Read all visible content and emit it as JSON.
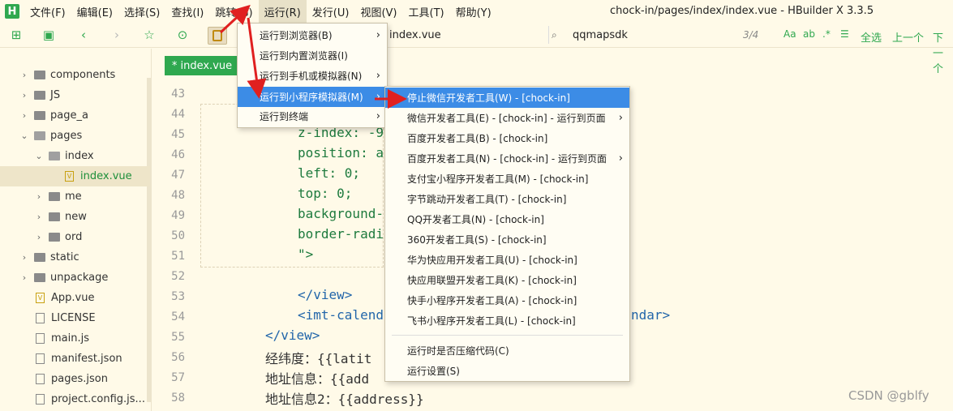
{
  "menubar": {
    "items": [
      "文件(F)",
      "编辑(E)",
      "选择(S)",
      "查找(I)",
      "跳转(G)",
      "运行(R)",
      "发行(U)",
      "视图(V)",
      "工具(T)",
      "帮助(Y)"
    ],
    "logo": "H",
    "window_title": "chock-in/pages/index/index.vue - HBuilder X 3.3.5"
  },
  "toolbar": {
    "breadcrumb_tail": "index.vue",
    "search_value": "qqmapsdk",
    "search_count": "3/4",
    "search_opts": [
      "Aa",
      "ab",
      ".*"
    ],
    "select_all": "全选",
    "prev": "上一个",
    "next": "下一个"
  },
  "sidebar": {
    "items": [
      {
        "label": "components",
        "type": "folder"
      },
      {
        "label": "JS",
        "type": "folder"
      },
      {
        "label": "page_a",
        "type": "folder"
      },
      {
        "label": "pages",
        "type": "folder-open"
      },
      {
        "label": "index",
        "type": "folder-open"
      },
      {
        "label": "index.vue",
        "type": "vue"
      },
      {
        "label": "me",
        "type": "folder"
      },
      {
        "label": "new",
        "type": "folder"
      },
      {
        "label": "ord",
        "type": "folder"
      },
      {
        "label": "static",
        "type": "folder"
      },
      {
        "label": "unpackage",
        "type": "folder"
      },
      {
        "label": "App.vue",
        "type": "vue"
      },
      {
        "label": "LICENSE",
        "type": "file"
      },
      {
        "label": "main.js",
        "type": "file"
      },
      {
        "label": "manifest.json",
        "type": "file"
      },
      {
        "label": "pages.json",
        "type": "file"
      },
      {
        "label": "project.config.js...",
        "type": "file"
      }
    ]
  },
  "editor": {
    "tab_label": "* index.vue",
    "line_numbers": [
      "43",
      "44",
      "45",
      "46",
      "47",
      "48",
      "49",
      "50",
      "51",
      "52",
      "53",
      "54",
      "55",
      "56",
      "57",
      "58"
    ],
    "lines": [
      {
        "text": "",
        "cls": ""
      },
      {
        "text": "",
        "cls": ""
      },
      {
        "text": "z-index: -9",
        "cls": "attr"
      },
      {
        "text": "position: a",
        "cls": "attr"
      },
      {
        "text": "left: 0;",
        "cls": "attr"
      },
      {
        "text": "top: 0;",
        "cls": "attr"
      },
      {
        "text": "background-",
        "cls": "attr"
      },
      {
        "text": "border-radi",
        "cls": "attr"
      },
      {
        "text": "\">",
        "cls": "attr"
      },
      {
        "text": "",
        "cls": ""
      },
      {
        "text": "</view>",
        "cls": "tag"
      },
      {
        "text": "<imt-calend",
        "cls": "tag"
      },
      {
        "text": "</view>",
        "cls": "tag"
      },
      {
        "text": "经纬度：{{latit",
        "cls": ""
      },
      {
        "text": "地址信息：{{add",
        "cls": ""
      },
      {
        "text": "地址信息2：{{address}}",
        "cls": ""
      }
    ],
    "line54_tail": "ndar>"
  },
  "run_menu": {
    "items": [
      {
        "label": "运行到浏览器(B)",
        "arrow": true
      },
      {
        "label": "运行到内置浏览器(I)",
        "arrow": false
      },
      {
        "label": "运行到手机或模拟器(N)",
        "arrow": true
      },
      {
        "label": "运行到小程序模拟器(M)",
        "arrow": true,
        "highlight": true
      },
      {
        "label": "运行到终端",
        "arrow": true
      }
    ]
  },
  "submenu": {
    "items": [
      {
        "label": "停止微信开发者工具(W) - [chock-in]",
        "arrow": false,
        "highlight": true
      },
      {
        "label": "微信开发者工具(E) - [chock-in] - 运行到页面",
        "arrow": true
      },
      {
        "label": "百度开发者工具(B) - [chock-in]",
        "arrow": false
      },
      {
        "label": "百度开发者工具(N) - [chock-in] - 运行到页面",
        "arrow": true
      },
      {
        "label": "支付宝小程序开发者工具(M) - [chock-in]",
        "arrow": false
      },
      {
        "label": "字节跳动开发者工具(T) - [chock-in]",
        "arrow": false
      },
      {
        "label": "QQ开发者工具(N) - [chock-in]",
        "arrow": false
      },
      {
        "label": "360开发者工具(S) - [chock-in]",
        "arrow": false
      },
      {
        "label": "华为快应用开发者工具(U) - [chock-in]",
        "arrow": false
      },
      {
        "label": "快应用联盟开发者工具(K) - [chock-in]",
        "arrow": false
      },
      {
        "label": "快手小程序开发者工具(A) - [chock-in]",
        "arrow": false
      },
      {
        "label": "飞书小程序开发者工具(L) - [chock-in]",
        "arrow": false
      }
    ],
    "extra_items": [
      {
        "label": "运行时是否压缩代码(C)"
      },
      {
        "label": "运行设置(S)"
      }
    ]
  },
  "icons": {
    "arrow_right": "›",
    "chevron_right": "›",
    "chevron_down": "⌄"
  },
  "watermark": "CSDN @gblfy"
}
